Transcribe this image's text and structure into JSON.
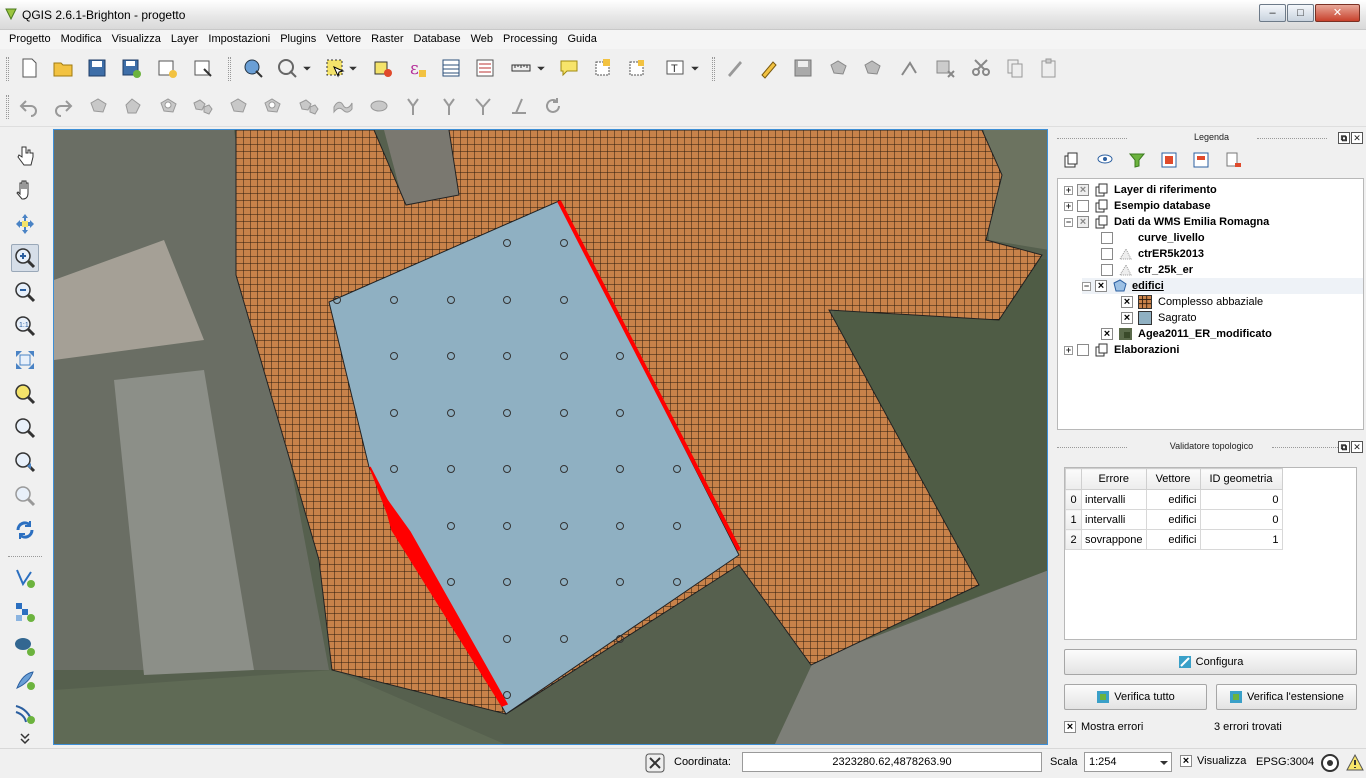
{
  "window": {
    "title": "QGIS 2.6.1-Brighton - progetto",
    "minimize_glyph": "‒",
    "maximize_glyph": "□",
    "close_glyph": "✕"
  },
  "menu": [
    "Progetto",
    "Modifica",
    "Visualizza",
    "Layer",
    "Impostazioni",
    "Plugins",
    "Vettore",
    "Raster",
    "Database",
    "Web",
    "Processing",
    "Guida"
  ],
  "legend_panel": {
    "title": "Legenda",
    "layers": [
      {
        "label": "Layer di riferimento",
        "type": "group",
        "checked": "partial"
      },
      {
        "label": "Esempio database",
        "type": "group",
        "checked": "none"
      },
      {
        "label": "Dati da WMS Emilia Romagna",
        "type": "group",
        "checked": "partial"
      },
      {
        "label": "curve_livello",
        "type": "layer",
        "checked": "none"
      },
      {
        "label": "ctrER5k2013",
        "type": "layer",
        "checked": "none"
      },
      {
        "label": "ctr_25k_er",
        "type": "layer",
        "checked": "none"
      },
      {
        "label": "edifici",
        "type": "layer",
        "checked": "checked",
        "selected": true
      },
      {
        "label": "Complesso abbaziale",
        "type": "class",
        "checked": "checked"
      },
      {
        "label": "Sagrato",
        "type": "class",
        "checked": "checked"
      },
      {
        "label": "Agea2011_ER_modificato",
        "type": "layer",
        "checked": "checked"
      },
      {
        "label": "Elaborazioni",
        "type": "group",
        "checked": "none"
      }
    ]
  },
  "topology_panel": {
    "title": "Validatore topologico",
    "columns": [
      "Errore",
      "Vettore",
      "ID geometria"
    ],
    "rows": [
      {
        "index": "0",
        "error": "intervalli",
        "layer": "edifici",
        "id": "0"
      },
      {
        "index": "1",
        "error": "intervalli",
        "layer": "edifici",
        "id": "0"
      },
      {
        "index": "2",
        "error": "sovrappone",
        "layer": "edifici",
        "id": "1"
      }
    ],
    "configure_label": "Configura",
    "verify_all_label": "Verifica tutto",
    "verify_extent_label": "Verifica l'estensione",
    "show_errors_label": "Mostra errori",
    "show_errors_checked": true,
    "errors_found": "3 errori trovati"
  },
  "statusbar": {
    "coord_label": "Coordinata:",
    "coord_value": "2323280.62,4878263.90",
    "scale_label": "Scala",
    "scale_value": "1:254",
    "render_label": "Visualizza",
    "render_checked": true,
    "crs": "EPSG:3004"
  },
  "colors": {
    "complesso_fill": "#c8824a",
    "sagrato_fill": "#8fb0c2",
    "error_line": "#ff0000",
    "selection_border": "#3e8fd6"
  },
  "panel_buttons": {
    "float": "⧉",
    "close": "✕"
  }
}
